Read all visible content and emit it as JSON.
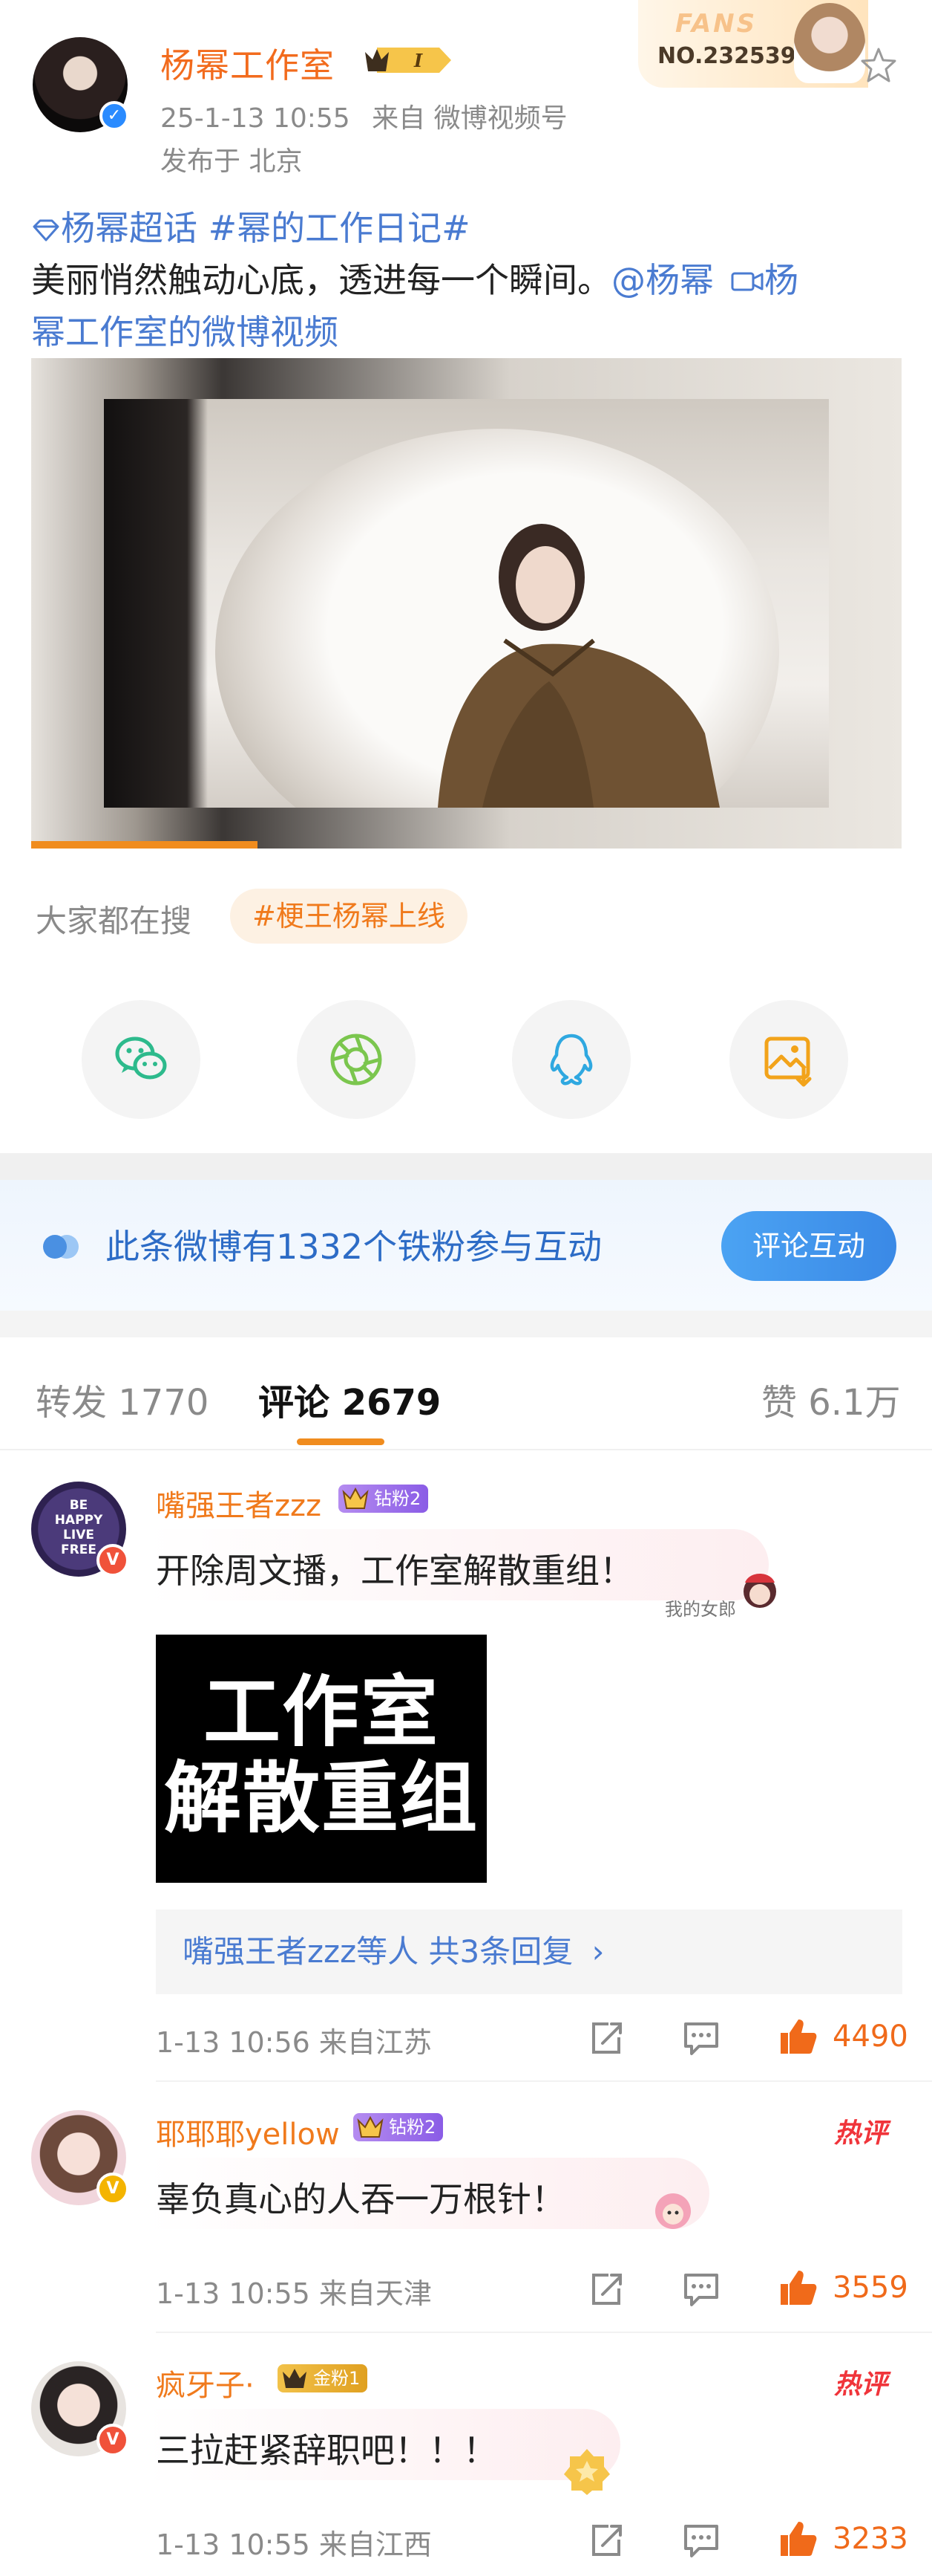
{
  "post": {
    "author": "杨幂工作室",
    "level_badge": "I",
    "time": "25-1-13 10:55",
    "source": "来自 微博视频号",
    "location": "发布于 北京",
    "fans_card": {
      "label": "FANS",
      "number": "NO.232539"
    },
    "text": {
      "topic1": "杨幂超话",
      "topic2": "#幂的工作日记#",
      "body": "美丽悄然触动心底，透进每一个瞬间。",
      "mention": "@杨幂",
      "video_link_line1": "杨",
      "video_link_line2": "幂工作室的微博视频"
    },
    "video_progress": 0.26
  },
  "search": {
    "title": "大家都在搜",
    "tag": "#梗王杨幂上线"
  },
  "share": [
    "wechat-icon",
    "moments-icon",
    "qq-icon",
    "save-image-icon"
  ],
  "fan_interact": {
    "text": "此条微博有1332个铁粉参与互动",
    "button": "评论互动"
  },
  "tabs": {
    "repost": "转发 1770",
    "comment": "评论 2679",
    "like": "赞 6.1万"
  },
  "comments": [
    {
      "name": "嘴强王者zzz",
      "fan_badge": "钻粉2",
      "text": "开除周文播，工作室解散重组！",
      "sticker": "我的女郎",
      "image_text_line1": "工作室",
      "image_text_line2": "解散重组",
      "replies": "嘴强王者zzz等人  共3条回复",
      "time": "1-13 10:56  来自江苏",
      "likes": "4490",
      "avatar_text": "BE HAPPY LIVE FREE"
    },
    {
      "name": "耶耶耶yellow",
      "fan_badge": "钻粉2",
      "hot": "热评",
      "text": "辜负真心的人吞一万根针！",
      "time": "1-13 10:55  来自天津",
      "likes": "3559"
    },
    {
      "name": "疯牙子·",
      "fan_badge": "金粉1",
      "hot": "热评",
      "text": "三拉赶紧辞职吧！！！",
      "time": "1-13 10:55  来自江西",
      "likes": "3233"
    }
  ],
  "colors": {
    "accent_orange": "#f07a1c",
    "link_blue": "#4a7bd1",
    "hot_red": "#f0343a",
    "like_orange": "#f06a1a",
    "fan_blue": "#2d6cc6"
  }
}
